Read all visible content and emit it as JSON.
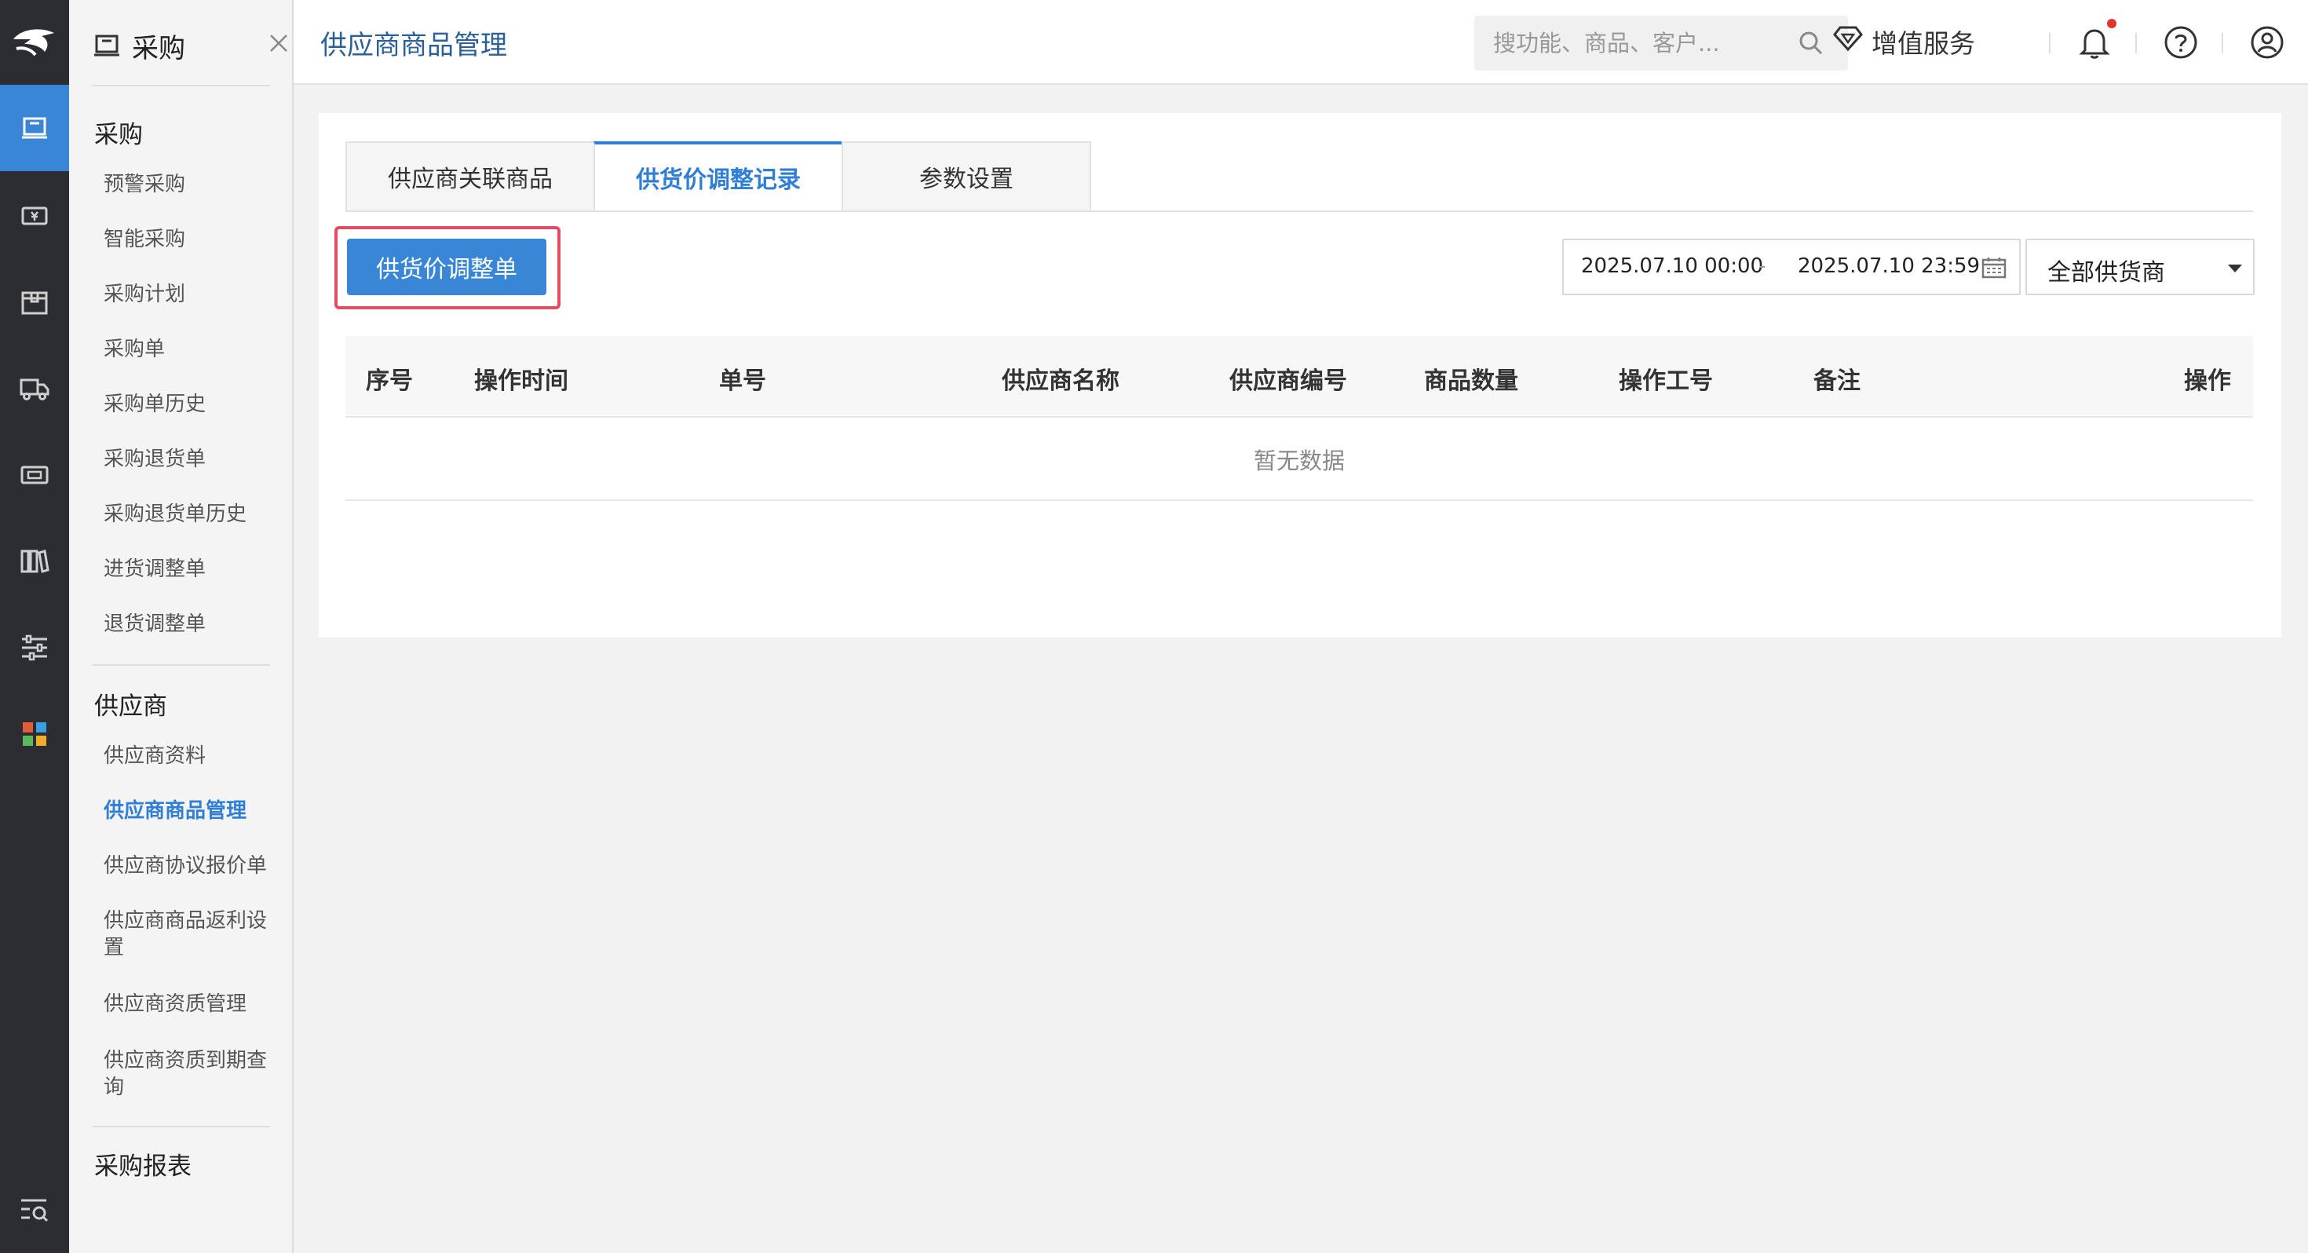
{
  "rail": {
    "logo": "brand-logo",
    "icons": [
      "purchase-icon",
      "cashier-icon",
      "package-icon",
      "delivery-truck-icon",
      "member-card-icon",
      "library-icon",
      "settings-sliders-icon",
      "apps-grid-icon",
      "search-list-icon"
    ],
    "active_index": 0,
    "active_color": "#3a86d6"
  },
  "menu": {
    "title": "采购",
    "sections": [
      {
        "label": "采购",
        "items": [
          "预警采购",
          "智能采购",
          "采购计划",
          "采购单",
          "采购单历史",
          "采购退货单",
          "采购退货单历史",
          "进货调整单",
          "退货调整单"
        ]
      },
      {
        "label": "供应商",
        "items": [
          "供应商资料",
          "供应商商品管理",
          "供应商协议报价单",
          "供应商商品返利设置",
          "供应商资质管理",
          "供应商资质到期查询"
        ]
      },
      {
        "label": "采购报表",
        "items": []
      }
    ],
    "active_item": "供应商商品管理"
  },
  "header": {
    "page_title": "供应商商品管理",
    "search_placeholder": "搜功能、商品、客户...",
    "value_added": "增值服务"
  },
  "tabs": [
    {
      "label": "供应商关联商品",
      "active": false
    },
    {
      "label": "供货价调整记录",
      "active": true
    },
    {
      "label": "参数设置",
      "active": false
    }
  ],
  "toolbar": {
    "primary_button": "供货价调整单",
    "date_start": "2025.07.10 00:00",
    "date_sep": "-",
    "date_end": "2025.07.10 23:59",
    "supplier_select": "全部供货商"
  },
  "table": {
    "columns": [
      "序号",
      "操作时间",
      "单号",
      "供应商名称",
      "供应商编号",
      "商品数量",
      "操作工号",
      "备注",
      "操作"
    ],
    "empty_text": "暂无数据"
  },
  "colors": {
    "accent": "#3a86d6",
    "highlight": "#e74a63",
    "rail_bg": "#2c2d32"
  }
}
